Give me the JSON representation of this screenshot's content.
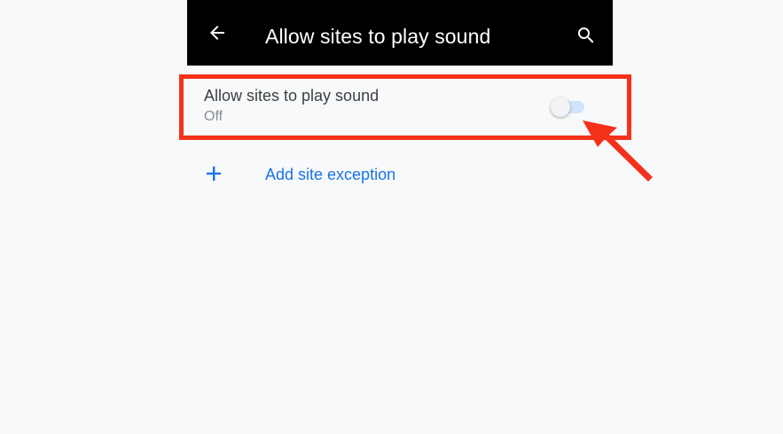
{
  "app_bar": {
    "title": "Allow sites to play sound",
    "back_icon": "arrow-left-icon",
    "search_icon": "search-icon",
    "background": "#000000"
  },
  "setting": {
    "title": "Allow sites to play sound",
    "status": "Off",
    "toggle_on": false
  },
  "add_exception": {
    "icon": "plus-icon",
    "label": "Add site exception",
    "color": "#1a73e8"
  },
  "annotation": {
    "highlight_color": "#f4311b",
    "arrow_icon": "red-arrow-pointer"
  }
}
